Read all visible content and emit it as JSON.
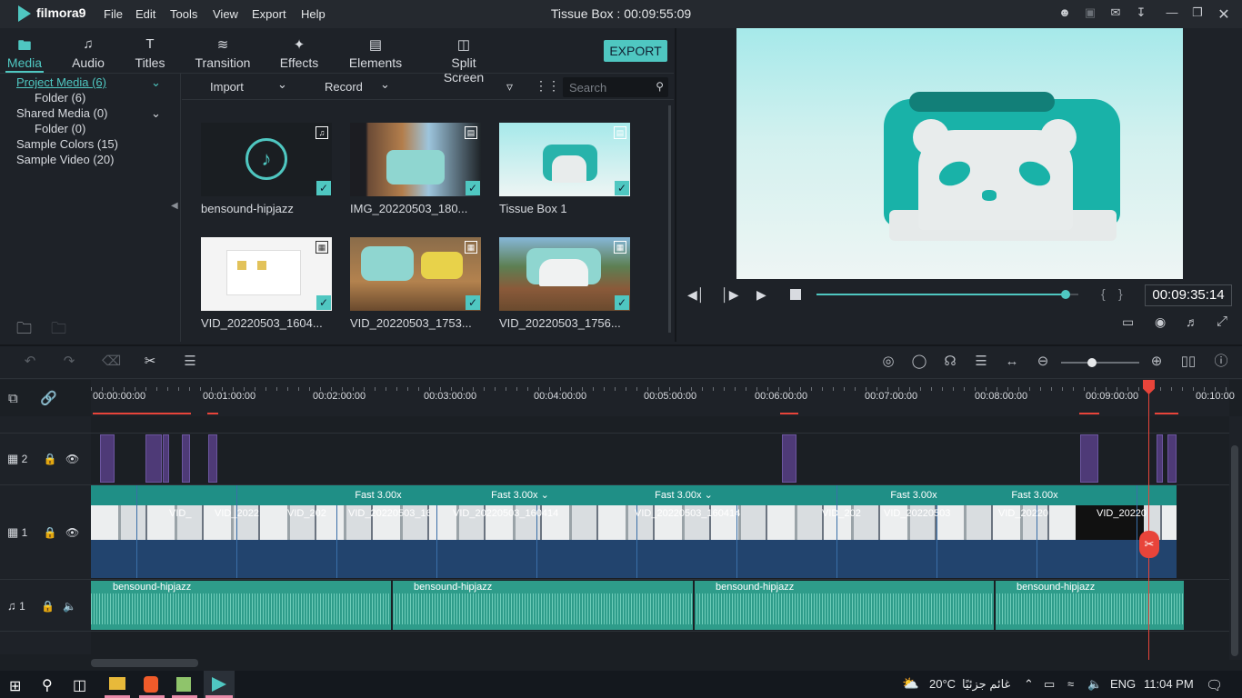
{
  "app": {
    "logo": "filmora9",
    "title": "Tissue Box : 00:09:55:09"
  },
  "menu": [
    "File",
    "Edit",
    "Tools",
    "View",
    "Export",
    "Help"
  ],
  "tabs": [
    {
      "label": "Media",
      "icon": "folder-icon"
    },
    {
      "label": "Audio",
      "icon": "music-note-icon"
    },
    {
      "label": "Titles",
      "icon": "text-icon"
    },
    {
      "label": "Transition",
      "icon": "transition-icon"
    },
    {
      "label": "Effects",
      "icon": "effects-icon"
    },
    {
      "label": "Elements",
      "icon": "image-icon"
    },
    {
      "label": "Split Screen",
      "icon": "split-screen-icon"
    }
  ],
  "export_label": "EXPORT",
  "tree": [
    {
      "label": "Project Media (6)"
    },
    {
      "label": "Folder (6)"
    },
    {
      "label": "Shared Media (0)"
    },
    {
      "label": "Folder (0)"
    },
    {
      "label": "Sample Colors (15)"
    },
    {
      "label": "Sample Video (20)"
    }
  ],
  "media_toolbar": {
    "import": "Import",
    "record": "Record",
    "search_placeholder": "Search"
  },
  "media_items": [
    {
      "label": "bensound-hipjazz",
      "type": "audio"
    },
    {
      "label": "IMG_20220503_180...",
      "type": "image"
    },
    {
      "label": "Tissue Box 1",
      "type": "image"
    },
    {
      "label": "VID_20220503_1604...",
      "type": "video"
    },
    {
      "label": "VID_20220503_1753...",
      "type": "video"
    },
    {
      "label": "VID_20220503_1756...",
      "type": "video"
    }
  ],
  "preview": {
    "time": "00:09:35:14",
    "progress": 0.95
  },
  "ruler_labels": [
    "00:00:00:00",
    "00:01:00:00",
    "00:02:00:00",
    "00:03:00:00",
    "00:04:00:00",
    "00:05:00:00",
    "00:06:00:00",
    "00:07:00:00",
    "00:08:00:00",
    "00:09:00:00",
    "00:10:00"
  ],
  "tracks": [
    {
      "label": "2"
    },
    {
      "label": "1"
    },
    {
      "label": "1"
    }
  ],
  "speed_labels": [
    "Fast 3.00x",
    "Fast 3.00x",
    "Fast 3.00x",
    "Fast 3.00x",
    "Fast 3.00x"
  ],
  "clip_labels": [
    "VID_",
    "VID_2022",
    "VID_202",
    "VID_20220503_16",
    "VID_20220503_160414",
    "VID_20220503_160414",
    "VID_202",
    "VID_20220503",
    "VID_20220",
    "VID_20220"
  ],
  "audio_labels": [
    "bensound-hipjazz",
    "bensound-hipjazz",
    "bensound-hipjazz",
    "bensound-hipjazz"
  ],
  "taskbar": {
    "weather": "20°C",
    "weather_text": "غائم جزئيًا",
    "lang": "ENG",
    "clock": "11:04 PM"
  }
}
